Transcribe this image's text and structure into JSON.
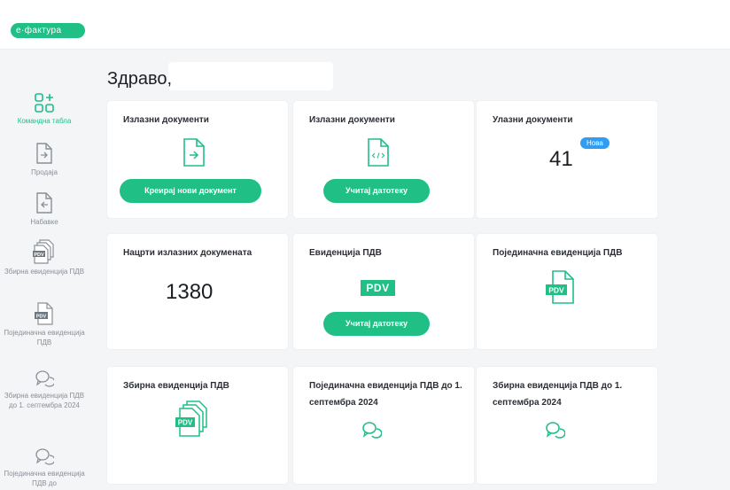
{
  "brand": {
    "logo_text": "е·фактура",
    "accent": "#1fbf86",
    "badge_color": "#2f9df3"
  },
  "sidebar": {
    "items": [
      {
        "label": "Командна табла",
        "icon": "dashboard-plus-icon",
        "active": true
      },
      {
        "label": "Продаја",
        "icon": "document-arrow-right-icon"
      },
      {
        "label": "Набавке",
        "icon": "document-arrow-left-icon"
      },
      {
        "label": "Збирна евиденција ПДВ",
        "icon": "pdv-stack-icon"
      },
      {
        "label": "Појединачна евиденција ПДВ",
        "icon": "pdv-document-icon"
      },
      {
        "label": "Збирна евиденција ПДВ до 1. септембра 2024",
        "icon": "chat-bubbles-icon"
      },
      {
        "label": "Појединачна евиденција ПДВ до",
        "icon": "chat-bubbles-icon"
      }
    ]
  },
  "main": {
    "greeting": "Здраво,",
    "cards": {
      "outgoing_create": {
        "title": "Излазни документи",
        "button": "Креирај нови документ",
        "icon": "document-arrow-right-icon"
      },
      "outgoing_upload": {
        "title": "Излазни документи",
        "button": "Учитај датотеку",
        "icon": "xml-document-icon"
      },
      "incoming": {
        "title": "Улазни документи",
        "count": "41",
        "badge": "Нова"
      },
      "drafts": {
        "title": "Нацрти излазних докумената",
        "count": "1380"
      },
      "vat_record": {
        "title": "Евиденција ПДВ",
        "tag": "PDV",
        "button": "Учитај датотеку"
      },
      "single_vat": {
        "title": "Појединачна евиденција ПДВ",
        "icon": "pdv-document-icon"
      },
      "summary_vat": {
        "title": "Збирна евиденција ПДВ",
        "icon": "pdv-stack-icon"
      },
      "single_vat_2024": {
        "title": "Појединачна евиденција ПДВ до 1. септембра 2024",
        "icon": "chat-bubbles-icon"
      },
      "summary_vat_2024": {
        "title": "Збирна евиденција ПДВ до 1. септембра 2024",
        "icon": "chat-bubbles-icon"
      }
    }
  }
}
